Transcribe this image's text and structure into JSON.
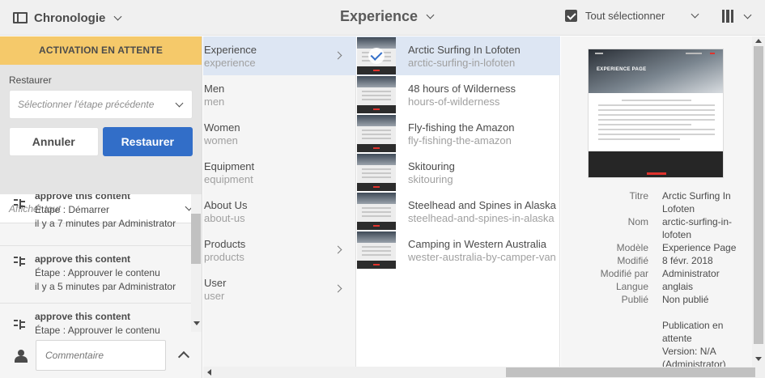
{
  "topbar": {
    "rail_label": "Chronologie",
    "page_title": "Experience",
    "select_all_label": "Tout sélectionner"
  },
  "rail": {
    "banner": "ACTIVATION EN ATTENTE",
    "restore_label": "Restaurer",
    "restore_placeholder": "Sélectionner l'étape précédente",
    "cancel_label": "Annuler",
    "restore_button": "Restaurer",
    "filter_label": "Afficher tout",
    "comment_placeholder": "Commentaire",
    "timeline": [
      {
        "title": "approve this content",
        "step": "Étape : Démarrer",
        "meta": "il y a 7 minutes par Administrator"
      },
      {
        "title": "approve this content",
        "step": "Étape : Approuver le contenu",
        "meta": "il y a 5 minutes par Administrator"
      },
      {
        "title": "approve this content",
        "step": "Étape : Approuver le contenu",
        "meta": ""
      }
    ]
  },
  "columns": {
    "col1": [
      {
        "title": "Experience",
        "name": "experience",
        "has_children": true,
        "active": true
      },
      {
        "title": "Men",
        "name": "men",
        "has_children": false
      },
      {
        "title": "Women",
        "name": "women",
        "has_children": false
      },
      {
        "title": "Equipment",
        "name": "equipment",
        "has_children": false
      },
      {
        "title": "About Us",
        "name": "about-us",
        "has_children": false
      },
      {
        "title": "Products",
        "name": "products",
        "has_children": true
      },
      {
        "title": "User",
        "name": "user",
        "has_children": true
      }
    ],
    "col2": [
      {
        "title": "Arctic Surfing In Lofoten",
        "name": "arctic-surfing-in-lofoten",
        "selected": true
      },
      {
        "title": "48 hours of Wilderness",
        "name": "hours-of-wilderness"
      },
      {
        "title": "Fly-fishing the Amazon",
        "name": "fly-fishing-the-amazon"
      },
      {
        "title": "Skitouring",
        "name": "skitouring"
      },
      {
        "title": "Steelhead and Spines in Alaska",
        "name": "steelhead-and-spines-in-alaska"
      },
      {
        "title": "Camping in Western Australia",
        "name": "wester-australia-by-camper-van"
      }
    ]
  },
  "preview": {
    "hero_title": "EXPERIENCE PAGE",
    "properties": [
      {
        "label": "Titre",
        "value": "Arctic Surfing In Lofoten"
      },
      {
        "label": "Nom",
        "value": "arctic-surfing-in-lofoten"
      },
      {
        "label": "Modèle",
        "value": "Experience Page"
      },
      {
        "label": "Modifié",
        "value": "8 févr. 2018"
      },
      {
        "label": "Modifié par",
        "value": "Administrator"
      },
      {
        "label": "Langue",
        "value": "anglais"
      },
      {
        "label": "Publié",
        "value": "Non publié"
      },
      {
        "label": "",
        "value": "Publication en attente"
      },
      {
        "label": "",
        "value": "Version: N/A (Administrator)"
      }
    ]
  },
  "colors": {
    "banner": "#f5c96a",
    "primary_button": "#326ec8",
    "selection": "#dde6f3"
  }
}
